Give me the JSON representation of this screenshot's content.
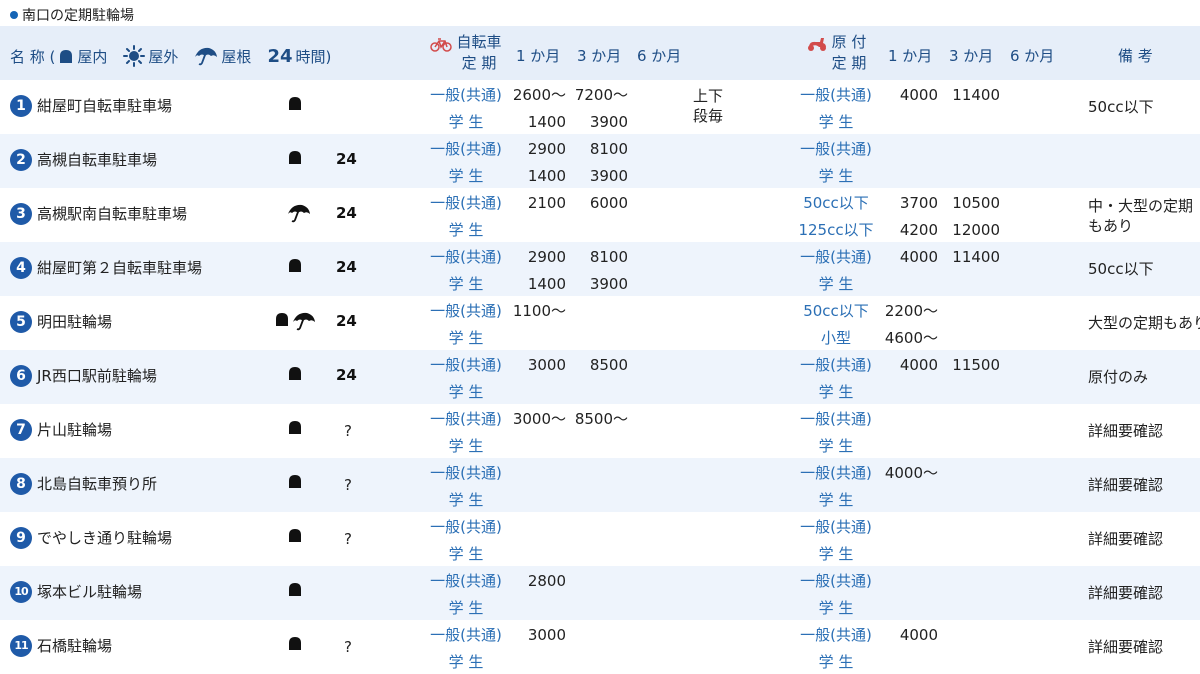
{
  "title": "南口の定期駐輪場",
  "header": {
    "name_label": "名 称 (",
    "indoor_label": "屋内",
    "outdoor_label": "屋外",
    "roof_label": "屋根",
    "h24_label": "24",
    "h24_suffix": "時間)",
    "bike_line1": "自転車",
    "bike_line2": "定 期",
    "month1": "1 か月",
    "month3": "3 か月",
    "month6": "6 か月",
    "moped_line1": "原 付",
    "moped_line2": "定 期",
    "moped_month1": "1 か月",
    "moped_month3": "3 か月",
    "moped_month6": "6 か月",
    "note_label": "備 考"
  },
  "colors": {
    "accent": "#1f5aa8",
    "header_bg": "#e6eef9",
    "alt_row_bg": "#eef4fc",
    "type_text": "#2b6fb5"
  },
  "rows": [
    {
      "num": "1",
      "name": "紺屋町自転車駐車場",
      "icons": [
        "indoor"
      ],
      "h24": "",
      "question": "",
      "b_type1": "一般(共通)",
      "b_m1_1": "2600〜",
      "b_m3_1": "7200〜",
      "b_type2": "学 生",
      "b_m1_2": "1400",
      "b_m3_2": "3900",
      "extra": "上下段毎",
      "m_type1": "一般(共通)",
      "m_m1_1": "4000",
      "m_m3_1": "11400",
      "m_type2": "学 生",
      "m_m1_2": "",
      "m_m3_2": "",
      "note": "50cc以下"
    },
    {
      "num": "2",
      "name": "高槻自転車駐車場",
      "icons": [
        "indoor"
      ],
      "h24": "24",
      "question": "",
      "b_type1": "一般(共通)",
      "b_m1_1": "2900",
      "b_m3_1": "8100",
      "b_type2": "学 生",
      "b_m1_2": "1400",
      "b_m3_2": "3900",
      "extra": "",
      "m_type1": "一般(共通)",
      "m_m1_1": "",
      "m_m3_1": "",
      "m_type2": "学 生",
      "m_m1_2": "",
      "m_m3_2": "",
      "note": ""
    },
    {
      "num": "3",
      "name": "高槻駅南自転車駐車場",
      "icons": [
        "roof"
      ],
      "h24": "24",
      "question": "",
      "b_type1": "一般(共通)",
      "b_m1_1": "2100",
      "b_m3_1": "6000",
      "b_type2": "学 生",
      "b_m1_2": "",
      "b_m3_2": "",
      "extra": "",
      "m_type1": "50cc以下",
      "m_m1_1": "3700",
      "m_m3_1": "10500",
      "m_type2": "125cc以下",
      "m_m1_2": "4200",
      "m_m3_2": "12000",
      "note": "中・大型の定期もあり"
    },
    {
      "num": "4",
      "name": "紺屋町第２自転車駐車場",
      "icons": [
        "indoor"
      ],
      "h24": "24",
      "question": "",
      "b_type1": "一般(共通)",
      "b_m1_1": "2900",
      "b_m3_1": "8100",
      "b_type2": "学 生",
      "b_m1_2": "1400",
      "b_m3_2": "3900",
      "extra": "",
      "m_type1": "一般(共通)",
      "m_m1_1": "4000",
      "m_m3_1": "11400",
      "m_type2": "学 生",
      "m_m1_2": "",
      "m_m3_2": "",
      "note": "50cc以下"
    },
    {
      "num": "5",
      "name": "明田駐輪場",
      "icons": [
        "indoor",
        "roof"
      ],
      "h24": "24",
      "question": "",
      "b_type1": "一般(共通)",
      "b_m1_1": "1100〜",
      "b_m3_1": "",
      "b_type2": "学 生",
      "b_m1_2": "",
      "b_m3_2": "",
      "extra": "",
      "m_type1": "50cc以下",
      "m_m1_1": "2200〜",
      "m_m3_1": "",
      "m_type2": "小型",
      "m_m1_2": "4600〜",
      "m_m3_2": "",
      "note": "大型の定期もあり"
    },
    {
      "num": "6",
      "name": "JR西口駅前駐輪場",
      "icons": [
        "indoor"
      ],
      "h24": "24",
      "question": "",
      "b_type1": "一般(共通)",
      "b_m1_1": "3000",
      "b_m3_1": "8500",
      "b_type2": "学 生",
      "b_m1_2": "",
      "b_m3_2": "",
      "extra": "",
      "m_type1": "一般(共通)",
      "m_m1_1": "4000",
      "m_m3_1": "11500",
      "m_type2": "学 生",
      "m_m1_2": "",
      "m_m3_2": "",
      "note": "原付のみ"
    },
    {
      "num": "7",
      "name": "片山駐輪場",
      "icons": [
        "indoor"
      ],
      "h24": "",
      "question": "?",
      "b_type1": "一般(共通)",
      "b_m1_1": "3000〜",
      "b_m3_1": "8500〜",
      "b_type2": "学 生",
      "b_m1_2": "",
      "b_m3_2": "",
      "extra": "",
      "m_type1": "一般(共通)",
      "m_m1_1": "",
      "m_m3_1": "",
      "m_type2": "学 生",
      "m_m1_2": "",
      "m_m3_2": "",
      "note": "詳細要確認"
    },
    {
      "num": "8",
      "name": "北島自転車預り所",
      "icons": [
        "indoor"
      ],
      "h24": "",
      "question": "?",
      "b_type1": "一般(共通)",
      "b_m1_1": "",
      "b_m3_1": "",
      "b_type2": "学 生",
      "b_m1_2": "",
      "b_m3_2": "",
      "extra": "",
      "m_type1": "一般(共通)",
      "m_m1_1": "4000〜",
      "m_m3_1": "",
      "m_type2": "学 生",
      "m_m1_2": "",
      "m_m3_2": "",
      "note": "詳細要確認"
    },
    {
      "num": "9",
      "name": "でやしき通り駐輪場",
      "icons": [
        "indoor"
      ],
      "h24": "",
      "question": "?",
      "b_type1": "一般(共通)",
      "b_m1_1": "",
      "b_m3_1": "",
      "b_type2": "学 生",
      "b_m1_2": "",
      "b_m3_2": "",
      "extra": "",
      "m_type1": "一般(共通)",
      "m_m1_1": "",
      "m_m3_1": "",
      "m_type2": "学 生",
      "m_m1_2": "",
      "m_m3_2": "",
      "note": "詳細要確認"
    },
    {
      "num": "10",
      "name": "塚本ビル駐輪場",
      "icons": [
        "indoor"
      ],
      "h24": "",
      "question": "",
      "b_type1": "一般(共通)",
      "b_m1_1": "2800",
      "b_m3_1": "",
      "b_type2": "学 生",
      "b_m1_2": "",
      "b_m3_2": "",
      "extra": "",
      "m_type1": "一般(共通)",
      "m_m1_1": "",
      "m_m3_1": "",
      "m_type2": "学 生",
      "m_m1_2": "",
      "m_m3_2": "",
      "note": "詳細要確認"
    },
    {
      "num": "11",
      "name": "石橋駐輪場",
      "icons": [
        "indoor"
      ],
      "h24": "",
      "question": "?",
      "b_type1": "一般(共通)",
      "b_m1_1": "3000",
      "b_m3_1": "",
      "b_type2": "学 生",
      "b_m1_2": "",
      "b_m3_2": "",
      "extra": "",
      "m_type1": "一般(共通)",
      "m_m1_1": "4000",
      "m_m3_1": "",
      "m_type2": "学 生",
      "m_m1_2": "",
      "m_m3_2": "",
      "note": "詳細要確認"
    }
  ]
}
